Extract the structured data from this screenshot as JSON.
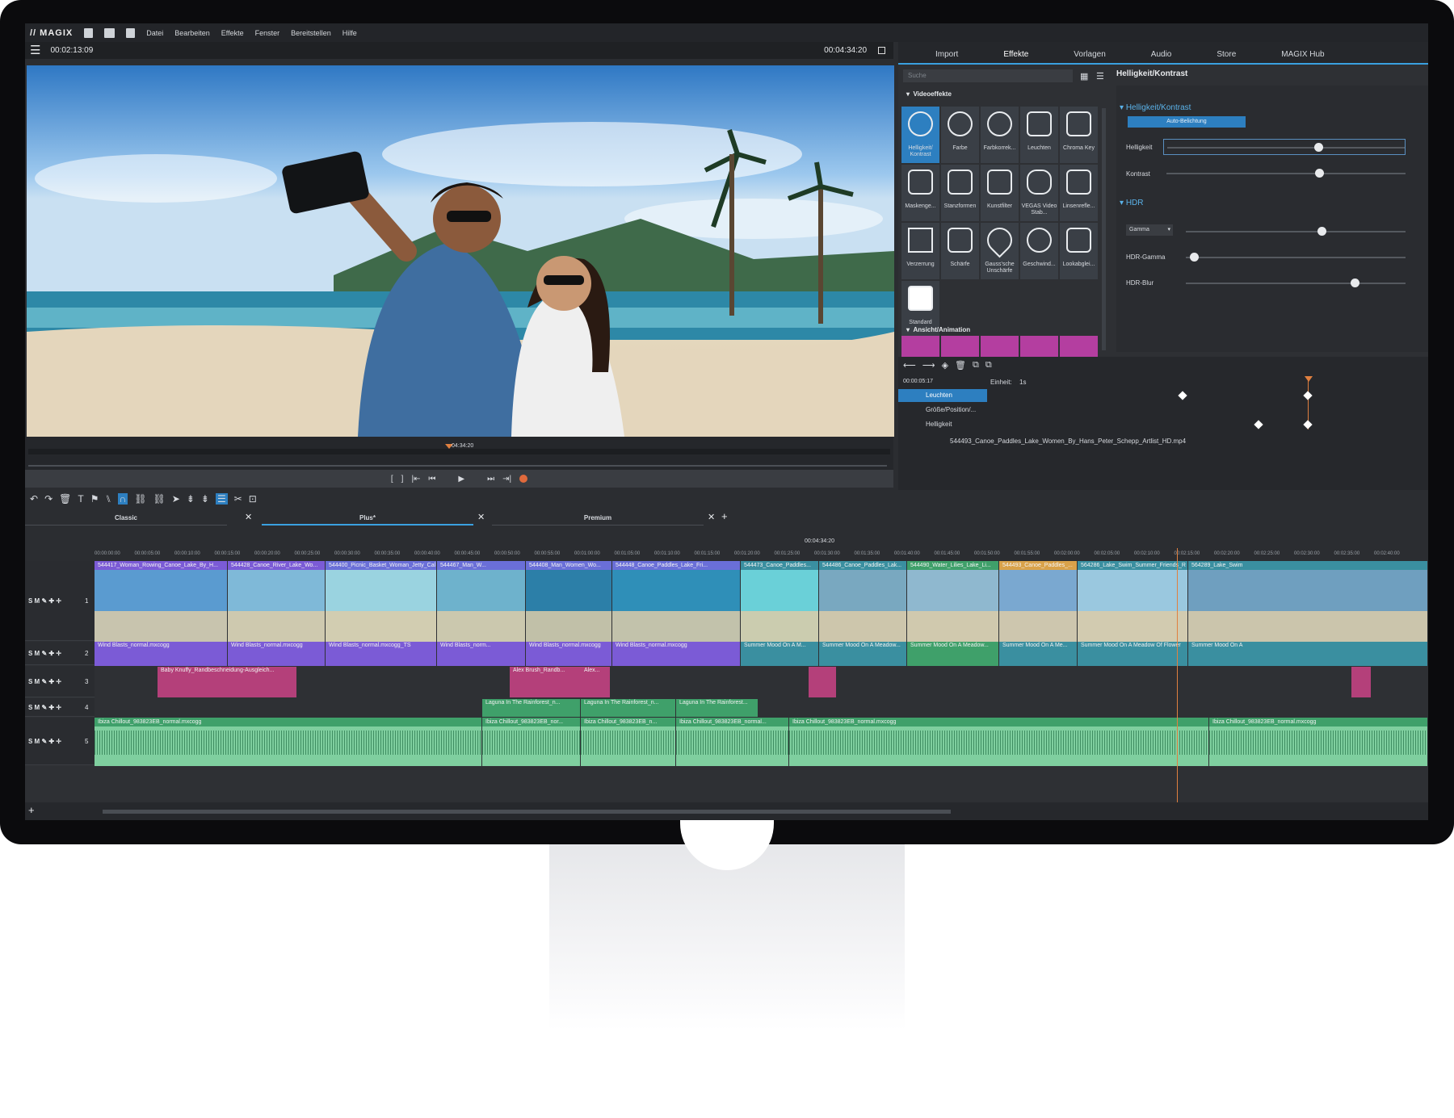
{
  "menu": {
    "logo": "MAGIX",
    "items": [
      "Datei",
      "Bearbeiten",
      "Effekte",
      "Fenster",
      "Bereitstellen",
      "Hilfe"
    ]
  },
  "preview": {
    "current_time": "00:02:13:09",
    "total_time": "00:04:34:20",
    "marker_time": "04:34:20"
  },
  "tabs": [
    "Import",
    "Effekte",
    "Vorlagen",
    "Audio",
    "Store",
    "MAGIX Hub"
  ],
  "active_tab": "Effekte",
  "search_placeholder": "Suche",
  "effects": {
    "section_video": "Videoeffekte",
    "section_view": "Ansicht/Animation",
    "items": [
      "Helligkeit/ Kontrast",
      "Farbe",
      "Farbkorrek...",
      "Leuchten",
      "Chroma Key",
      "Maskenge...",
      "Stanzformen",
      "Kunstfilter",
      "VEGAS Video Stab...",
      "Linsenrefle...",
      "Verzerrung",
      "Schärfe",
      "Gauss'sche Unschärfe",
      "Geschwind...",
      "Lookabglei...",
      "Standard"
    ]
  },
  "props": {
    "title": "Helligkeit/Kontrast",
    "group1": "Helligkeit/Kontrast",
    "auto_button": "Auto-Belichtung",
    "brightness_label": "Helligkeit",
    "contrast_label": "Kontrast",
    "group2": "HDR",
    "gamma_select": "Gamma",
    "hdr_gamma": "HDR-Gamma",
    "hdr_blur": "HDR-Blur",
    "brightness_value": 0.62,
    "contrast_value": 0.62,
    "gamma_value": 0.6,
    "hdr_gamma_value": 0.02,
    "hdr_blur_value": 0.75
  },
  "keyframes": {
    "time": "00:00:05:17",
    "unit_label": "Einheit:",
    "unit_value": "1s",
    "rows": [
      "Leuchten",
      "Größe/Position/...",
      "Helligkeit"
    ],
    "file_name": "544493_Canoe_Paddles_Lake_Women_By_Hans_Peter_Schepp_Artlist_HD.mp4"
  },
  "timeline_tabs": [
    "Classic",
    "Plus*",
    "Premium"
  ],
  "playhead_time": "00:04:34:20",
  "ruler_labels": [
    "00:00:00:00",
    "00:00:05:00",
    "00:00:10:00",
    "00:00:15:00",
    "00:00:20:00",
    "00:00:25:00",
    "00:00:30:00",
    "00:00:35:00",
    "00:00:40:00",
    "00:00:45:00",
    "00:00:50:00",
    "00:00:55:00",
    "00:01:00:00",
    "00:01:05:00",
    "00:01:10:00",
    "00:01:15:00",
    "00:01:20:00",
    "00:01:25:00",
    "00:01:30:00",
    "00:01:35:00",
    "00:01:40:00",
    "00:01:45:00",
    "00:01:50:00",
    "00:01:55:00",
    "00:02:00:00",
    "00:02:05:00",
    "00:02:10:00",
    "00:02:15:00",
    "00:02:20:00",
    "00:02:25:00",
    "00:02:30:00",
    "00:02:35:00",
    "00:02:40:00"
  ],
  "track_labels": {
    "sm": "S M",
    "t1": "1",
    "t2": "2",
    "t3": "3",
    "t4": "4",
    "t5": "5"
  },
  "video_clips": [
    "544417_Woman_Rowing_Canoe_Lake_By_H...",
    "544428_Canoe_River_Lake_Wo...",
    "544400_Picnic_Basket_Woman_Jetty_Cal",
    "544467_Man_W...",
    "544408_Man_Women_Wo...",
    "544448_Canoe_Paddles_Lake_Fri...",
    "544473_Canoe_Paddles...",
    "544486_Canoe_Paddles_Lak...",
    "544490_Water_Lilies_Lake_Li...",
    "544493_Canoe_Paddles_...",
    "564286_Lake_Swim_Summer_Friends_R",
    "564289_Lake_Swim"
  ],
  "audio2_clips": [
    "Wind Blasts_normal.mxcogg",
    "Wind Blasts_normal.mxcogg",
    "Wind Blasts_normal.mxcogg_TS",
    "Wind Blasts_norm...",
    "Wind Blasts_normal.mxcogg",
    "Wind Blasts_normal.mxcogg",
    "Summer Mood On A M...",
    "Summer Mood On A Meadow...",
    "Summer Mood On A Meadow...",
    "Summer Mood On A Me...",
    "Summer Mood On A Meadow Of Flower",
    "Summer Mood On A"
  ],
  "track3_clips": [
    "Baby Knuffy_Randbeschneidung-Ausgleich...",
    "Alex Brush_Randb...",
    "Alex..."
  ],
  "track4_clips": [
    "Laguna In The Rainforest_n...",
    "Laguna In The Rainforest_n...",
    "Laguna In The Rainforest..."
  ],
  "track5_clips": [
    "Ibiza Chillout_983823EB_normal.mxcogg",
    "Ibiza Chillout_983823EB_nor...",
    "Ibiza Chillout_983823EB_n...",
    "Ibiza Chillout_983823EB_normal...",
    "Ibiza Chillout_983823EB_normal.mxcogg",
    "Ibiza Chillout_983823EB_normal.mxcogg"
  ],
  "colors": {
    "accent": "#3aa0e0",
    "violet": "#7b5bd6",
    "pink": "#b4407a",
    "green": "#3fa06a",
    "teal": "#3a8fa0"
  }
}
